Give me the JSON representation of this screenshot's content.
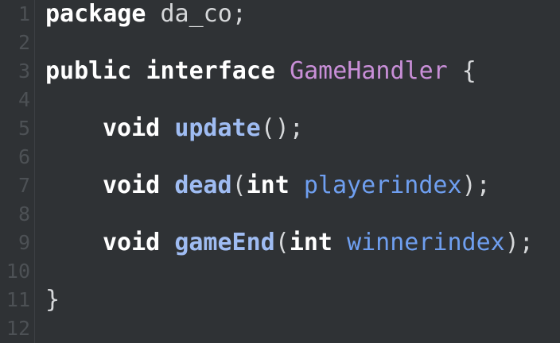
{
  "editor": {
    "line_numbers": [
      "1",
      "2",
      "3",
      "4",
      "5",
      "6",
      "7",
      "8",
      "9",
      "10",
      "11",
      "12"
    ],
    "lines": {
      "l1": {
        "kw": "package",
        "rest": " da_co;"
      },
      "l3": {
        "kw1": "public",
        "kw2": "interface",
        "type": "GameHandler",
        "brace": " {"
      },
      "l5": {
        "kw": "void",
        "fn": "update",
        "rest": "();"
      },
      "l7": {
        "kw": "void",
        "fn": "dead",
        "open": "(",
        "ptype": "int",
        "param": "playerindex",
        "close": ");"
      },
      "l9": {
        "kw": "void",
        "fn": "gameEnd",
        "open": "(",
        "ptype": "int",
        "param": "winnerindex",
        "close": ");"
      },
      "l11": {
        "brace": "}"
      }
    }
  }
}
